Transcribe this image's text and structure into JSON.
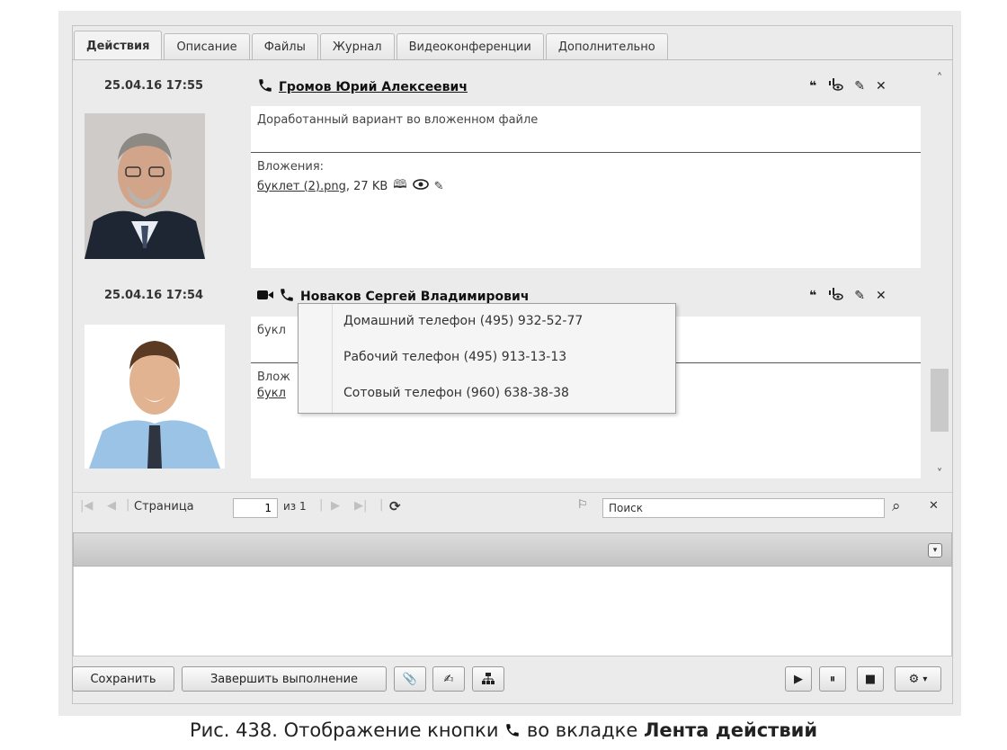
{
  "tabs": [
    "Действия",
    "Описание",
    "Файлы",
    "Журнал",
    "Видеоконференции",
    "Дополнительно"
  ],
  "entries": [
    {
      "date": "25.04.16 17:55",
      "author": "Громов Юрий Алексеевич",
      "message": "Доработанный вариант во вложенном файле",
      "attachments_label": "Вложения:",
      "attachment_link": "буклет (2).png",
      "attachment_size": ", 27 KB"
    },
    {
      "date": "25.04.16 17:54",
      "author": "Новаков Сергей Владимирович",
      "message_partial": "букл",
      "attachments_partial": "Влож",
      "attachment_partial": "букл"
    }
  ],
  "phone_menu": [
    "Домашний телефон (495) 932-52-77",
    "Рабочий телефон (495) 913-13-13",
    "Сотовый телефон (960) 638-38-38"
  ],
  "pager": {
    "page_label": "Страница",
    "page_value": "1",
    "of_label": "из 1",
    "search_placeholder": "Поиск"
  },
  "buttons": {
    "save": "Сохранить",
    "complete": "Завершить выполнение"
  },
  "caption": {
    "prefix": "Рис. 438. Отображение кнопки",
    "middle": "во вкладке",
    "bold": "Лента действий"
  },
  "icons": {
    "phone": "phone-icon",
    "video": "video-camera-icon",
    "quote": "quote-icon",
    "seen": "seen-by-icon",
    "edit": "pencil-icon",
    "delete": "close-icon",
    "book": "book-icon",
    "eye": "eye-icon"
  }
}
